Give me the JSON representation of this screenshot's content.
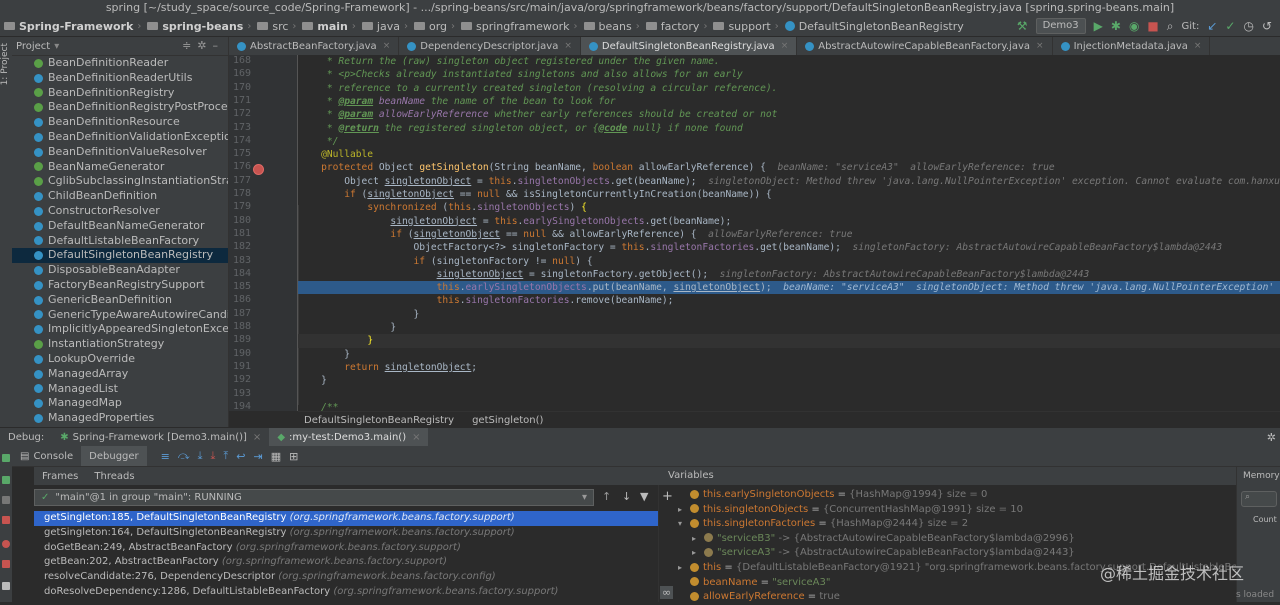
{
  "window": {
    "title": "spring [~/study_space/source_code/Spring-Framework] - .../spring-beans/src/main/java/org/springframework/beans/factory/support/DefaultSingletonBeanRegistry.java [spring.spring-beans.main]"
  },
  "breadcrumbs": [
    "Spring-Framework",
    "spring-beans",
    "src",
    "main",
    "java",
    "org",
    "springframework",
    "beans",
    "factory",
    "support",
    "DefaultSingletonBeanRegistry"
  ],
  "toolbar": {
    "run_config": "Demo3",
    "git_label": "Git:"
  },
  "left_stripe": {
    "project_label": "1: Project"
  },
  "project": {
    "header": "Project",
    "items": [
      "BeanDefinitionReader",
      "BeanDefinitionReaderUtils",
      "BeanDefinitionRegistry",
      "BeanDefinitionRegistryPostProcessor",
      "BeanDefinitionResource",
      "BeanDefinitionValidationException",
      "BeanDefinitionValueResolver",
      "BeanNameGenerator",
      "CglibSubclassingInstantiationStrategy",
      "ChildBeanDefinition",
      "ConstructorResolver",
      "DefaultBeanNameGenerator",
      "DefaultListableBeanFactory",
      "DefaultSingletonBeanRegistry",
      "DisposableBeanAdapter",
      "FactoryBeanRegistrySupport",
      "GenericBeanDefinition",
      "GenericTypeAwareAutowireCandidateR",
      "ImplicitlyAppearedSingletonException",
      "InstantiationStrategy",
      "LookupOverride",
      "ManagedArray",
      "ManagedList",
      "ManagedMap",
      "ManagedProperties"
    ],
    "selected": 13
  },
  "tabs": [
    {
      "label": "AbstractBeanFactory.java",
      "active": false
    },
    {
      "label": "DependencyDescriptor.java",
      "active": false
    },
    {
      "label": "DefaultSingletonBeanRegistry.java",
      "active": true
    },
    {
      "label": "AbstractAutowireCapableBeanFactory.java",
      "active": false
    },
    {
      "label": "InjectionMetadata.java",
      "active": false
    }
  ],
  "editor": {
    "line_numbers": [
      "168",
      "169",
      "170",
      "171",
      "172",
      "173",
      "174",
      "175",
      "176",
      "177",
      "178",
      "179",
      "180",
      "181",
      "182",
      "183",
      "184",
      "185",
      "186",
      "187",
      "188",
      "189",
      "190",
      "191",
      "192",
      "193",
      "194"
    ],
    "breadcrumb": [
      "DefaultSingletonBeanRegistry",
      "getSingleton()"
    ],
    "hints": {
      "l176": "beanName: \"serviceA3\"  allowEarlyReference: true",
      "l177": "singletonObject: Method threw 'java.lang.NullPointerException' exception. Cannot evaluate com.hanxueming.demo3.ServiceA3.toString()",
      "l181": "allowEarlyReference: true",
      "l182": "singletonFactory: AbstractAutowireCapableBeanFactory$lambda@2443",
      "l184": "singletonFactory: AbstractAutowireCapableBeanFactory$lambda@2443",
      "l185": "beanName: \"serviceA3\"  singletonObject: Method threw 'java.lang.NullPointerException' exception. Cannot evaluate com.hanxueming.demo3.ServiceA3.toString()"
    }
  },
  "debug": {
    "label": "Debug:",
    "sessions": [
      "Spring-Framework [Demo3.main()]",
      ":my-test:Demo3.main()"
    ],
    "subtabs": [
      "Console",
      "Debugger"
    ],
    "frames_tabs": [
      "Frames",
      "Threads"
    ],
    "thread": "\"main\"@1 in group \"main\": RUNNING",
    "frames": [
      {
        "method": "getSingleton:185, DefaultSingletonBeanRegistry",
        "pkg": "(org.springframework.beans.factory.support)"
      },
      {
        "method": "getSingleton:164, DefaultSingletonBeanRegistry",
        "pkg": "(org.springframework.beans.factory.support)"
      },
      {
        "method": "doGetBean:249, AbstractBeanFactory",
        "pkg": "(org.springframework.beans.factory.support)"
      },
      {
        "method": "getBean:202, AbstractBeanFactory",
        "pkg": "(org.springframework.beans.factory.support)"
      },
      {
        "method": "resolveCandidate:276, DependencyDescriptor",
        "pkg": "(org.springframework.beans.factory.config)"
      },
      {
        "method": "doResolveDependency:1286, DefaultListableBeanFactory",
        "pkg": "(org.springframework.beans.factory.support)"
      }
    ],
    "variables_header": "Variables",
    "variables": [
      {
        "name": "this.earlySingletonObjects",
        "value": "{HashMap@1994}  size = 0"
      },
      {
        "name": "this.singletonObjects",
        "value": "{ConcurrentHashMap@1991}  size = 10"
      },
      {
        "name": "this.singletonFactories",
        "value": "{HashMap@2444}  size = 2"
      },
      {
        "name": "\"serviceB3\"",
        "value": "-> {AbstractAutowireCapableBeanFactory$lambda@2996}"
      },
      {
        "name": "\"serviceA3\"",
        "value": "-> {AbstractAutowireCapableBeanFactory$lambda@2443}"
      },
      {
        "name": "this",
        "value": "{DefaultListableBeanFactory@1921} \"org.springframework.beans.factory.support.DefaultListableBeanFactory@"
      },
      {
        "name": "beanName",
        "value": "\"serviceA3\""
      },
      {
        "name": "allowEarlyReference",
        "value": "true"
      }
    ],
    "memory_label": "Memory",
    "count_label": "Count"
  },
  "watermark": "@稀土掘金技术社区",
  "status": "s loaded"
}
